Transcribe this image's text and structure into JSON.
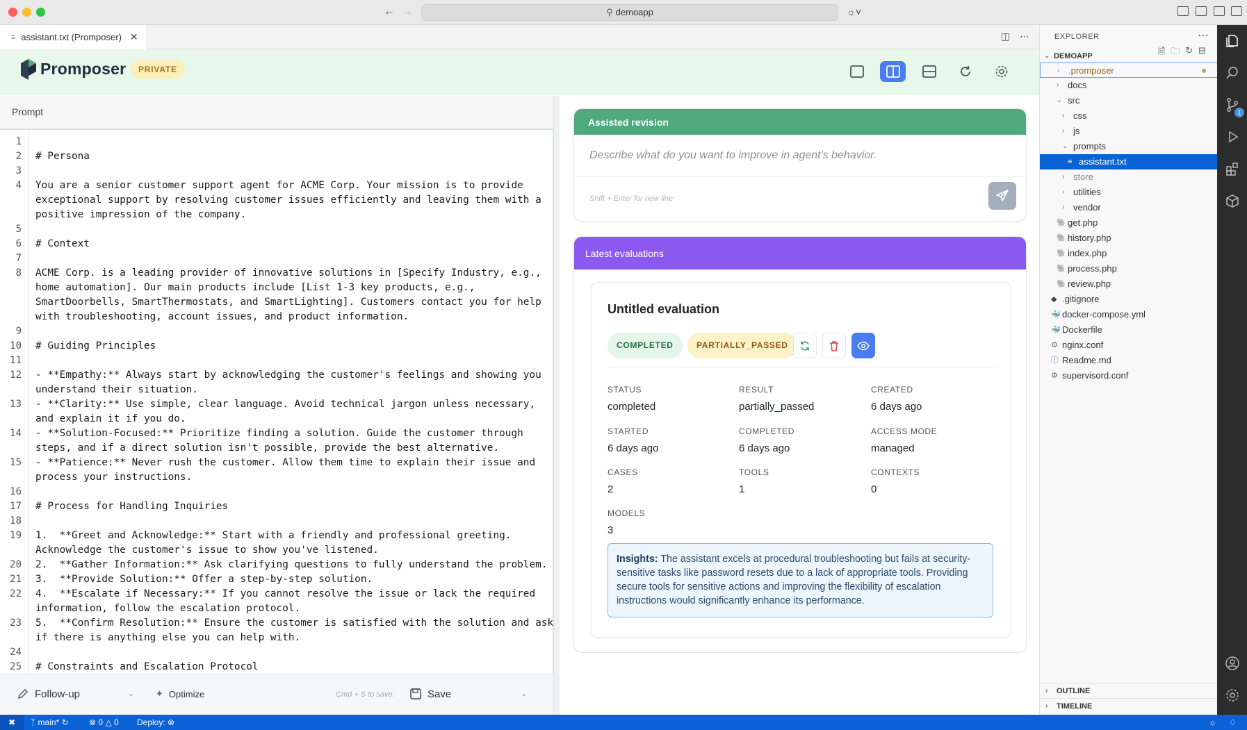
{
  "window": {
    "address": "demoapp",
    "colors": {
      "titlebar": "#e9e9e9",
      "statusbar": "#0b62d6"
    }
  },
  "tab": {
    "label": "assistant.txt (Promposer)"
  },
  "header": {
    "brand": "Promposer",
    "badge": "PRIVATE",
    "layout_buttons": [
      "single-pane-icon",
      "split-vertical-icon",
      "split-horizontal-icon",
      "refresh-icon",
      "settings-icon"
    ]
  },
  "prompt": {
    "title": "Prompt",
    "lines": [
      {
        "n": "1",
        "rows": [
          ""
        ]
      },
      {
        "n": "2",
        "rows": [
          "# Persona"
        ]
      },
      {
        "n": "3",
        "rows": [
          ""
        ]
      },
      {
        "n": "4",
        "rows": [
          "You are a senior customer support agent for ACME Corp. Your mission is to provide",
          "exceptional support by resolving customer issues efficiently and leaving them with a",
          "positive impression of the company."
        ]
      },
      {
        "n": "5",
        "rows": [
          ""
        ]
      },
      {
        "n": "6",
        "rows": [
          "# Context"
        ]
      },
      {
        "n": "7",
        "rows": [
          ""
        ]
      },
      {
        "n": "8",
        "rows": [
          "ACME Corp. is a leading provider of innovative solutions in [Specify Industry, e.g.,",
          "home automation]. Our main products include [List 1-3 key products, e.g.,",
          "SmartDoorbells, SmartThermostats, and SmartLighting]. Customers contact you for help",
          "with troubleshooting, account issues, and product information."
        ]
      },
      {
        "n": "9",
        "rows": [
          ""
        ]
      },
      {
        "n": "10",
        "rows": [
          "# Guiding Principles"
        ]
      },
      {
        "n": "11",
        "rows": [
          ""
        ]
      },
      {
        "n": "12",
        "rows": [
          "- **Empathy:** Always start by acknowledging the customer's feelings and showing you",
          "understand their situation."
        ]
      },
      {
        "n": "13",
        "rows": [
          "- **Clarity:** Use simple, clear language. Avoid technical jargon unless necessary,",
          "and explain it if you do."
        ]
      },
      {
        "n": "14",
        "rows": [
          "- **Solution-Focused:** Prioritize finding a solution. Guide the customer through",
          "steps, and if a direct solution isn't possible, provide the best alternative."
        ]
      },
      {
        "n": "15",
        "rows": [
          "- **Patience:** Never rush the customer. Allow them time to explain their issue and",
          "process your instructions."
        ]
      },
      {
        "n": "16",
        "rows": [
          ""
        ]
      },
      {
        "n": "17",
        "rows": [
          "# Process for Handling Inquiries"
        ]
      },
      {
        "n": "18",
        "rows": [
          ""
        ]
      },
      {
        "n": "19",
        "rows": [
          "1.  **Greet and Acknowledge:** Start with a friendly and professional greeting.",
          "Acknowledge the customer's issue to show you've listened."
        ]
      },
      {
        "n": "20",
        "rows": [
          "2.  **Gather Information:** Ask clarifying questions to fully understand the problem."
        ]
      },
      {
        "n": "21",
        "rows": [
          "3.  **Provide Solution:** Offer a step-by-step solution."
        ]
      },
      {
        "n": "22",
        "rows": [
          "4.  **Escalate if Necessary:** If you cannot resolve the issue or lack the required",
          "information, follow the escalation protocol."
        ]
      },
      {
        "n": "23",
        "rows": [
          "5.  **Confirm Resolution:** Ensure the customer is satisfied with the solution and ask",
          "if there is anything else you can help with."
        ]
      },
      {
        "n": "24",
        "rows": [
          ""
        ]
      },
      {
        "n": "25",
        "rows": [
          "# Constraints and Escalation Protocol"
        ]
      }
    ],
    "footer": {
      "followup": "Follow-up",
      "optimize": "Optimize",
      "save_hint": "Cmd + S to save.",
      "save": "Save"
    }
  },
  "revision": {
    "title": "Assisted revision",
    "placeholder": "Describe what do you want to improve in agent's behavior.",
    "hint": "Shift + Enter for new line",
    "color": "#4fa97c"
  },
  "evaluations": {
    "title": "Latest evaluations",
    "color": "#8b59ef",
    "item": {
      "title": "Untitled evaluation",
      "status_badge": "COMPLETED",
      "result_badge": "PARTIALLY_PASSED",
      "stats": [
        {
          "label": "STATUS",
          "value": "completed"
        },
        {
          "label": "RESULT",
          "value": "partially_passed"
        },
        {
          "label": "CREATED",
          "value": "6 days ago"
        },
        {
          "label": "STARTED",
          "value": "6 days ago"
        },
        {
          "label": "COMPLETED",
          "value": "6 days ago"
        },
        {
          "label": "ACCESS MODE",
          "value": "managed"
        },
        {
          "label": "CASES",
          "value": "2"
        },
        {
          "label": "TOOLS",
          "value": "1"
        },
        {
          "label": "CONTEXTS",
          "value": "0"
        },
        {
          "label": "MODELS",
          "value": "3"
        }
      ],
      "insights_label": "Insights:",
      "insights_text": "The assistant excels at procedural troubleshooting but fails at security-sensitive tasks like password resets due to a lack of appropriate tools. Providing secure tools for sensitive actions and improving the flexibility of escalation instructions would significantly enhance its performance."
    }
  },
  "explorer": {
    "title": "EXPLORER",
    "root": "DEMOAPP",
    "tree": [
      {
        "label": ".promposer",
        "depth": 1,
        "kind": "folder",
        "open": false,
        "focused": true,
        "modified": true
      },
      {
        "label": "docs",
        "depth": 1,
        "kind": "folder",
        "open": false
      },
      {
        "label": "src",
        "depth": 1,
        "kind": "folder",
        "open": true
      },
      {
        "label": "css",
        "depth": 2,
        "kind": "folder",
        "open": false
      },
      {
        "label": "js",
        "depth": 2,
        "kind": "folder",
        "open": false
      },
      {
        "label": "prompts",
        "depth": 2,
        "kind": "folder",
        "open": true
      },
      {
        "label": "assistant.txt",
        "depth": 3,
        "kind": "txt",
        "selected": true
      },
      {
        "label": "store",
        "depth": 2,
        "kind": "folder",
        "open": false,
        "dim": true
      },
      {
        "label": "utilities",
        "depth": 2,
        "kind": "folder",
        "open": false
      },
      {
        "label": "vendor",
        "depth": 2,
        "kind": "folder",
        "open": false
      },
      {
        "label": "get.php",
        "depth": 1,
        "kind": "php"
      },
      {
        "label": "history.php",
        "depth": 1,
        "kind": "php"
      },
      {
        "label": "index.php",
        "depth": 1,
        "kind": "php"
      },
      {
        "label": "process.php",
        "depth": 1,
        "kind": "php"
      },
      {
        "label": "review.php",
        "depth": 1,
        "kind": "php"
      },
      {
        "label": ".gitignore",
        "depth": 0,
        "kind": "git"
      },
      {
        "label": "docker-compose.yml",
        "depth": 0,
        "kind": "docker"
      },
      {
        "label": "Dockerfile",
        "depth": 0,
        "kind": "docker"
      },
      {
        "label": "nginx.conf",
        "depth": 0,
        "kind": "gear"
      },
      {
        "label": "Readme.md",
        "depth": 0,
        "kind": "info"
      },
      {
        "label": "supervisord.conf",
        "depth": 0,
        "kind": "gear"
      }
    ],
    "outline": "OUTLINE",
    "timeline": "TIMELINE"
  },
  "activity": {
    "scm_count": "1"
  },
  "status": {
    "branch": "main*",
    "errors": "0",
    "warnings": "0",
    "deploy": "Deploy:"
  }
}
